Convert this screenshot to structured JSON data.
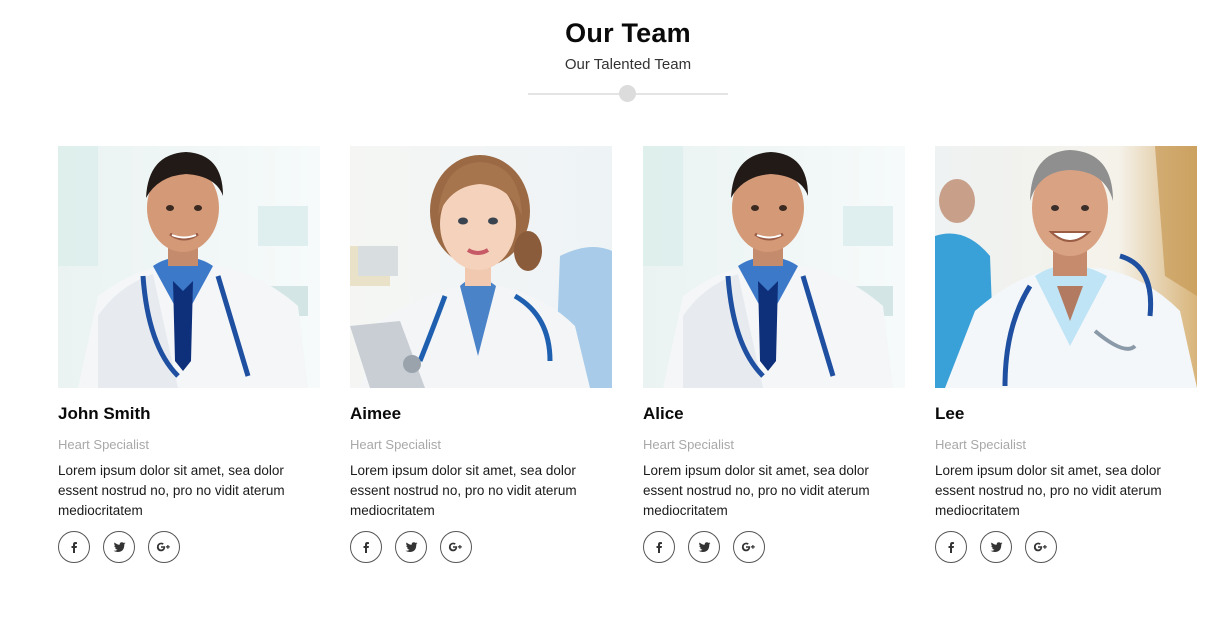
{
  "section": {
    "title": "Our Team",
    "subtitle": "Our Talented Team"
  },
  "members": [
    {
      "name": "John Smith",
      "role": "Heart Specialist",
      "bio": "Lorem ipsum dolor sit amet, sea dolor essent nostrud no, pro no vidit aterum mediocritatem",
      "photo": "male-doctor-blue-tie-photo"
    },
    {
      "name": "Aimee",
      "role": "Heart Specialist",
      "bio": "Lorem ipsum dolor sit amet, sea dolor essent nostrud no, pro no vidit aterum mediocritatem",
      "photo": "female-doctor-clipboard-photo"
    },
    {
      "name": "Alice",
      "role": "Heart Specialist",
      "bio": "Lorem ipsum dolor sit amet, sea dolor essent nostrud no, pro no vidit aterum mediocritatem",
      "photo": "male-doctor-blue-tie-photo"
    },
    {
      "name": "Lee",
      "role": "Heart Specialist",
      "bio": "Lorem ipsum dolor sit amet, sea dolor essent nostrud no, pro no vidit aterum mediocritatem",
      "photo": "grey-haired-doctor-photo"
    }
  ],
  "social_icons": [
    "facebook-icon",
    "twitter-icon",
    "google-plus-icon"
  ],
  "colors": {
    "title": "#0a0a0a",
    "role": "#a8a8a8",
    "divider": "#e4e4e4",
    "icon_border": "#555555"
  }
}
